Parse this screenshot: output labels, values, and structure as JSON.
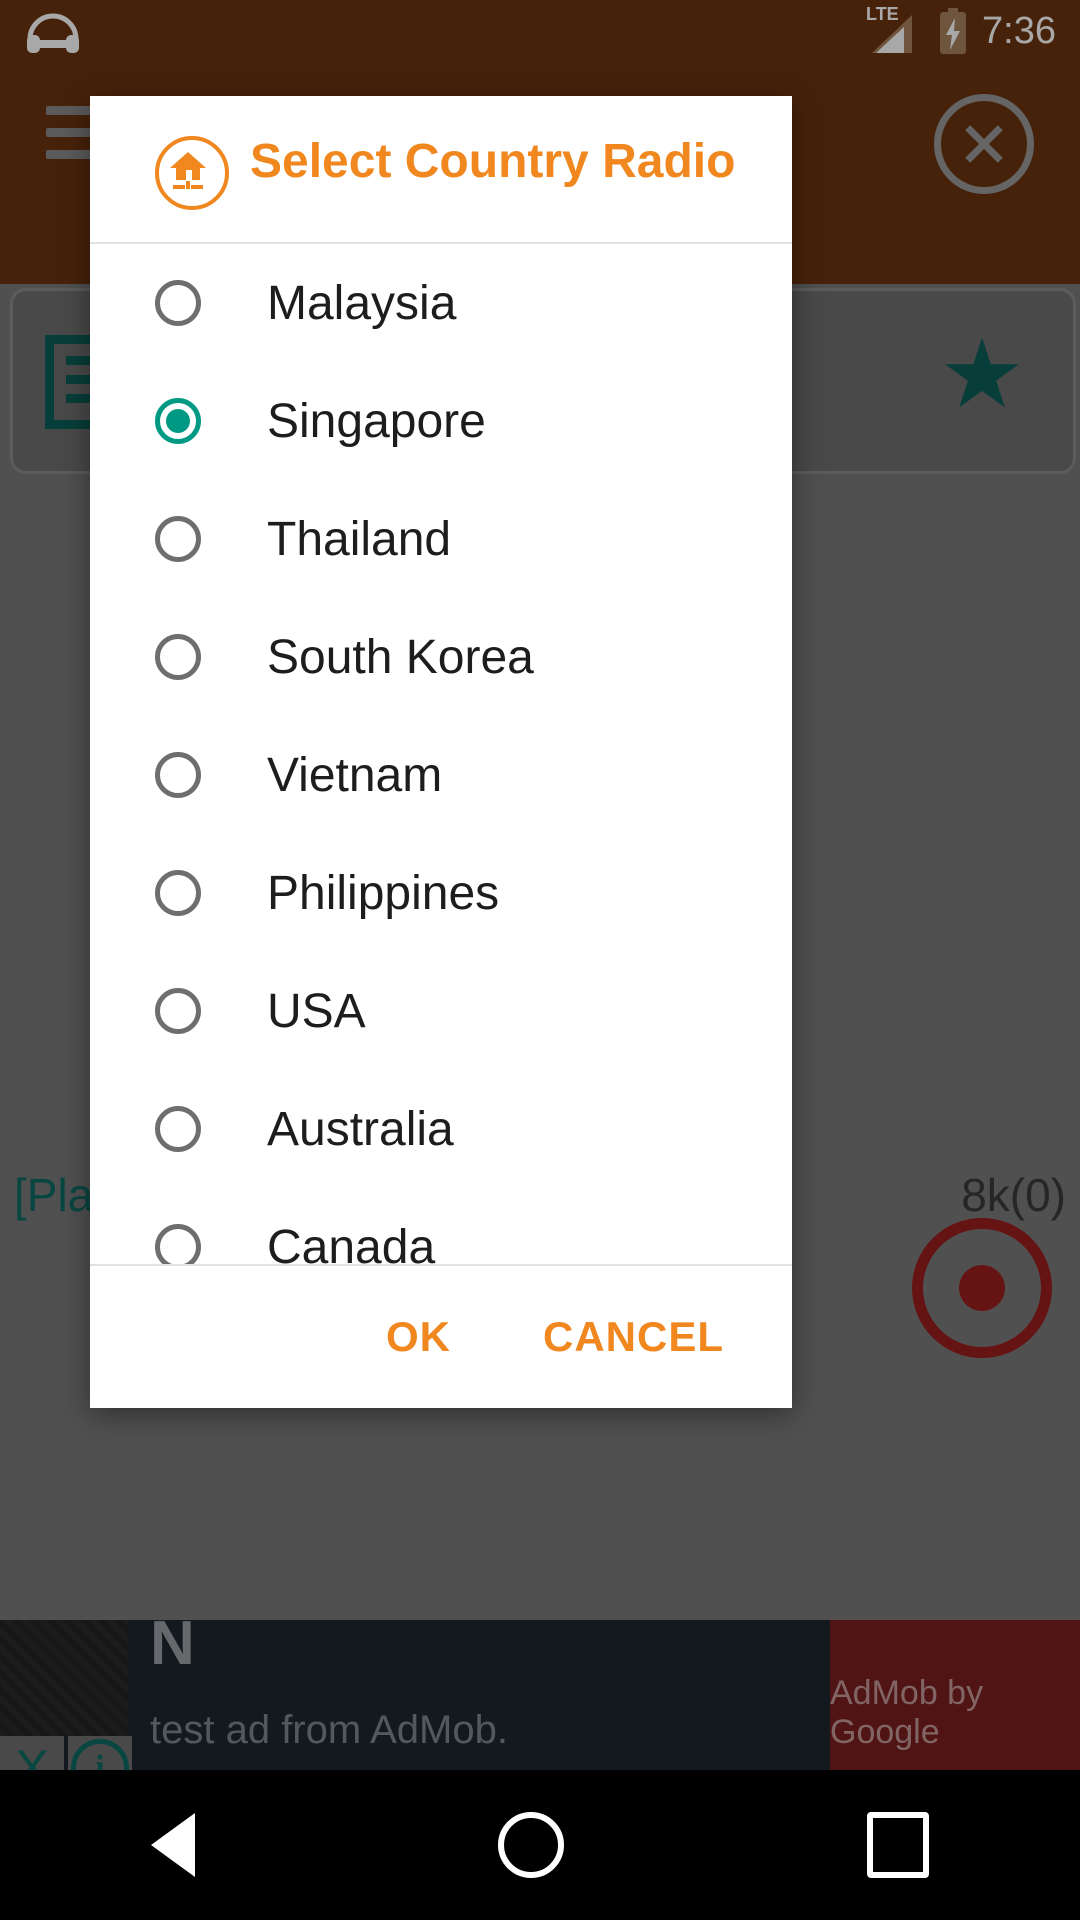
{
  "status_bar": {
    "left_icon": "headphones-icon",
    "network_label": "LTE",
    "signal_icon": "signal-bars-icon",
    "battery_icon": "battery-charging-icon",
    "time": "7:36"
  },
  "background_app": {
    "action_bar": {
      "menu_icon": "hamburger-menu-icon",
      "close_icon": "close-circle-icon",
      "background_color": "#6d3410"
    },
    "content_card": {
      "list_icon": "playlist-icon",
      "favorite_icon": "star-icon",
      "accent_color": "#0c5e57"
    },
    "player": {
      "status_text": "[Play",
      "bitrate_text": "8k(0)",
      "record_icon": "record-button-icon",
      "record_color": "#9b1d1d"
    },
    "ad_banner": {
      "title": "N",
      "subtitle": "test ad from AdMob.",
      "brand": "AdMob by Google",
      "close_label": "X",
      "info_label": "i",
      "brand_bg_color": "#7c1f1f"
    }
  },
  "dialog": {
    "icon": "home-radio-icon",
    "title": "Select Country Radio",
    "accent_color": "#f0871f",
    "selected_color": "#009a84",
    "selected_value": "Singapore",
    "options": [
      {
        "label": "Malaysia",
        "selected": false
      },
      {
        "label": "Singapore",
        "selected": true
      },
      {
        "label": "Thailand",
        "selected": false
      },
      {
        "label": "South Korea",
        "selected": false
      },
      {
        "label": "Vietnam",
        "selected": false
      },
      {
        "label": "Philippines",
        "selected": false
      },
      {
        "label": "USA",
        "selected": false
      },
      {
        "label": "Australia",
        "selected": false
      },
      {
        "label": "Canada",
        "selected": false
      }
    ],
    "buttons": {
      "ok_label": "OK",
      "cancel_label": "CANCEL"
    }
  },
  "navigation_bar": {
    "back_icon": "back-triangle-icon",
    "home_icon": "home-circle-icon",
    "recents_icon": "recents-square-icon"
  }
}
